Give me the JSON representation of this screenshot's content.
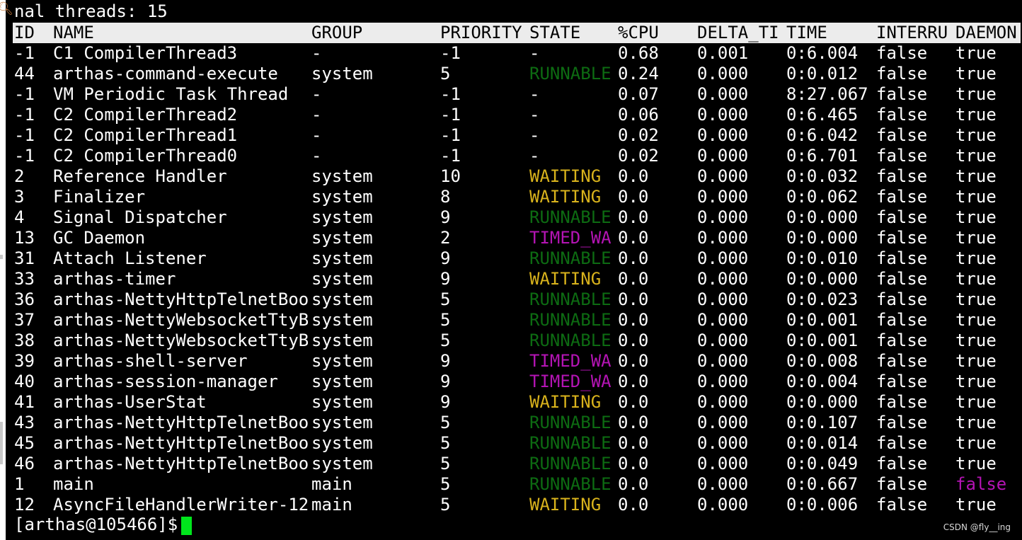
{
  "terminal": {
    "summary_line": "nal threads: 15",
    "prompt": "[arthas@105466]$ ",
    "watermark": "CSDN @fly__ing"
  },
  "columns": {
    "id": "ID",
    "name": "NAME",
    "group": "GROUP",
    "priority": "PRIORITY",
    "state": "STATE",
    "cpu": "%CPU",
    "delta_time": "DELTA_TI",
    "time": "TIME",
    "interrupted": "INTERRU",
    "daemon": "DAEMON"
  },
  "threads": [
    {
      "id": "-1",
      "name": "C1 CompilerThread3",
      "group": "-",
      "priority": "-1",
      "state": "-",
      "cpu": "0.68",
      "delta_time": "0.001",
      "time": "0:6.004",
      "interrupted": "false",
      "daemon": "true"
    },
    {
      "id": "44",
      "name": "arthas-command-execute",
      "group": "system",
      "priority": "5",
      "state": "RUNNABLE",
      "cpu": "0.24",
      "delta_time": "0.000",
      "time": "0:0.012",
      "interrupted": "false",
      "daemon": "true"
    },
    {
      "id": "-1",
      "name": "VM Periodic Task Thread",
      "group": "-",
      "priority": "-1",
      "state": "-",
      "cpu": "0.07",
      "delta_time": "0.000",
      "time": "8:27.067",
      "interrupted": "false",
      "daemon": "true"
    },
    {
      "id": "-1",
      "name": "C2 CompilerThread2",
      "group": "-",
      "priority": "-1",
      "state": "-",
      "cpu": "0.06",
      "delta_time": "0.000",
      "time": "0:6.465",
      "interrupted": "false",
      "daemon": "true"
    },
    {
      "id": "-1",
      "name": "C2 CompilerThread1",
      "group": "-",
      "priority": "-1",
      "state": "-",
      "cpu": "0.02",
      "delta_time": "0.000",
      "time": "0:6.042",
      "interrupted": "false",
      "daemon": "true"
    },
    {
      "id": "-1",
      "name": "C2 CompilerThread0",
      "group": "-",
      "priority": "-1",
      "state": "-",
      "cpu": "0.02",
      "delta_time": "0.000",
      "time": "0:6.701",
      "interrupted": "false",
      "daemon": "true"
    },
    {
      "id": "2",
      "name": "Reference Handler",
      "group": "system",
      "priority": "10",
      "state": "WAITING",
      "cpu": "0.0",
      "delta_time": "0.000",
      "time": "0:0.032",
      "interrupted": "false",
      "daemon": "true"
    },
    {
      "id": "3",
      "name": "Finalizer",
      "group": "system",
      "priority": "8",
      "state": "WAITING",
      "cpu": "0.0",
      "delta_time": "0.000",
      "time": "0:0.062",
      "interrupted": "false",
      "daemon": "true"
    },
    {
      "id": "4",
      "name": "Signal Dispatcher",
      "group": "system",
      "priority": "9",
      "state": "RUNNABLE",
      "cpu": "0.0",
      "delta_time": "0.000",
      "time": "0:0.000",
      "interrupted": "false",
      "daemon": "true"
    },
    {
      "id": "13",
      "name": "GC Daemon",
      "group": "system",
      "priority": "2",
      "state": "TIMED_WA",
      "cpu": "0.0",
      "delta_time": "0.000",
      "time": "0:0.000",
      "interrupted": "false",
      "daemon": "true"
    },
    {
      "id": "31",
      "name": "Attach Listener",
      "group": "system",
      "priority": "9",
      "state": "RUNNABLE",
      "cpu": "0.0",
      "delta_time": "0.000",
      "time": "0:0.010",
      "interrupted": "false",
      "daemon": "true"
    },
    {
      "id": "33",
      "name": "arthas-timer",
      "group": "system",
      "priority": "9",
      "state": "WAITING",
      "cpu": "0.0",
      "delta_time": "0.000",
      "time": "0:0.000",
      "interrupted": "false",
      "daemon": "true"
    },
    {
      "id": "36",
      "name": "arthas-NettyHttpTelnetBoo",
      "group": "system",
      "priority": "5",
      "state": "RUNNABLE",
      "cpu": "0.0",
      "delta_time": "0.000",
      "time": "0:0.023",
      "interrupted": "false",
      "daemon": "true"
    },
    {
      "id": "37",
      "name": "arthas-NettyWebsocketTtyB",
      "group": "system",
      "priority": "5",
      "state": "RUNNABLE",
      "cpu": "0.0",
      "delta_time": "0.000",
      "time": "0:0.001",
      "interrupted": "false",
      "daemon": "true"
    },
    {
      "id": "38",
      "name": "arthas-NettyWebsocketTtyB",
      "group": "system",
      "priority": "5",
      "state": "RUNNABLE",
      "cpu": "0.0",
      "delta_time": "0.000",
      "time": "0:0.001",
      "interrupted": "false",
      "daemon": "true"
    },
    {
      "id": "39",
      "name": "arthas-shell-server",
      "group": "system",
      "priority": "9",
      "state": "TIMED_WA",
      "cpu": "0.0",
      "delta_time": "0.000",
      "time": "0:0.008",
      "interrupted": "false",
      "daemon": "true"
    },
    {
      "id": "40",
      "name": "arthas-session-manager",
      "group": "system",
      "priority": "9",
      "state": "TIMED_WA",
      "cpu": "0.0",
      "delta_time": "0.000",
      "time": "0:0.004",
      "interrupted": "false",
      "daemon": "true"
    },
    {
      "id": "41",
      "name": "arthas-UserStat",
      "group": "system",
      "priority": "9",
      "state": "WAITING",
      "cpu": "0.0",
      "delta_time": "0.000",
      "time": "0:0.000",
      "interrupted": "false",
      "daemon": "true"
    },
    {
      "id": "43",
      "name": "arthas-NettyHttpTelnetBoo",
      "group": "system",
      "priority": "5",
      "state": "RUNNABLE",
      "cpu": "0.0",
      "delta_time": "0.000",
      "time": "0:0.107",
      "interrupted": "false",
      "daemon": "true"
    },
    {
      "id": "45",
      "name": "arthas-NettyHttpTelnetBoo",
      "group": "system",
      "priority": "5",
      "state": "RUNNABLE",
      "cpu": "0.0",
      "delta_time": "0.000",
      "time": "0:0.014",
      "interrupted": "false",
      "daemon": "true"
    },
    {
      "id": "46",
      "name": "arthas-NettyHttpTelnetBoo",
      "group": "system",
      "priority": "5",
      "state": "RUNNABLE",
      "cpu": "0.0",
      "delta_time": "0.000",
      "time": "0:0.049",
      "interrupted": "false",
      "daemon": "true"
    },
    {
      "id": "1",
      "name": "main",
      "group": "main",
      "priority": "5",
      "state": "RUNNABLE",
      "cpu": "0.0",
      "delta_time": "0.000",
      "time": "0:0.667",
      "interrupted": "false",
      "daemon": "false"
    },
    {
      "id": "12",
      "name": "AsyncFileHandlerWriter-12",
      "group": "main",
      "priority": "5",
      "state": "WAITING",
      "cpu": "0.0",
      "delta_time": "0.000",
      "time": "0:0.006",
      "interrupted": "false",
      "daemon": "true"
    }
  ],
  "colors": {
    "background": "#000000",
    "text": "#ffffff",
    "header_background": "#ececec",
    "header_text": "#000000",
    "state_runnable": "#0d6b12",
    "state_waiting": "#d8b21c",
    "state_timed_waiting": "#b414b4",
    "daemon_false": "#b414b4",
    "cursor": "#00e51c"
  },
  "icons": {
    "left_edge": "search-icon"
  }
}
